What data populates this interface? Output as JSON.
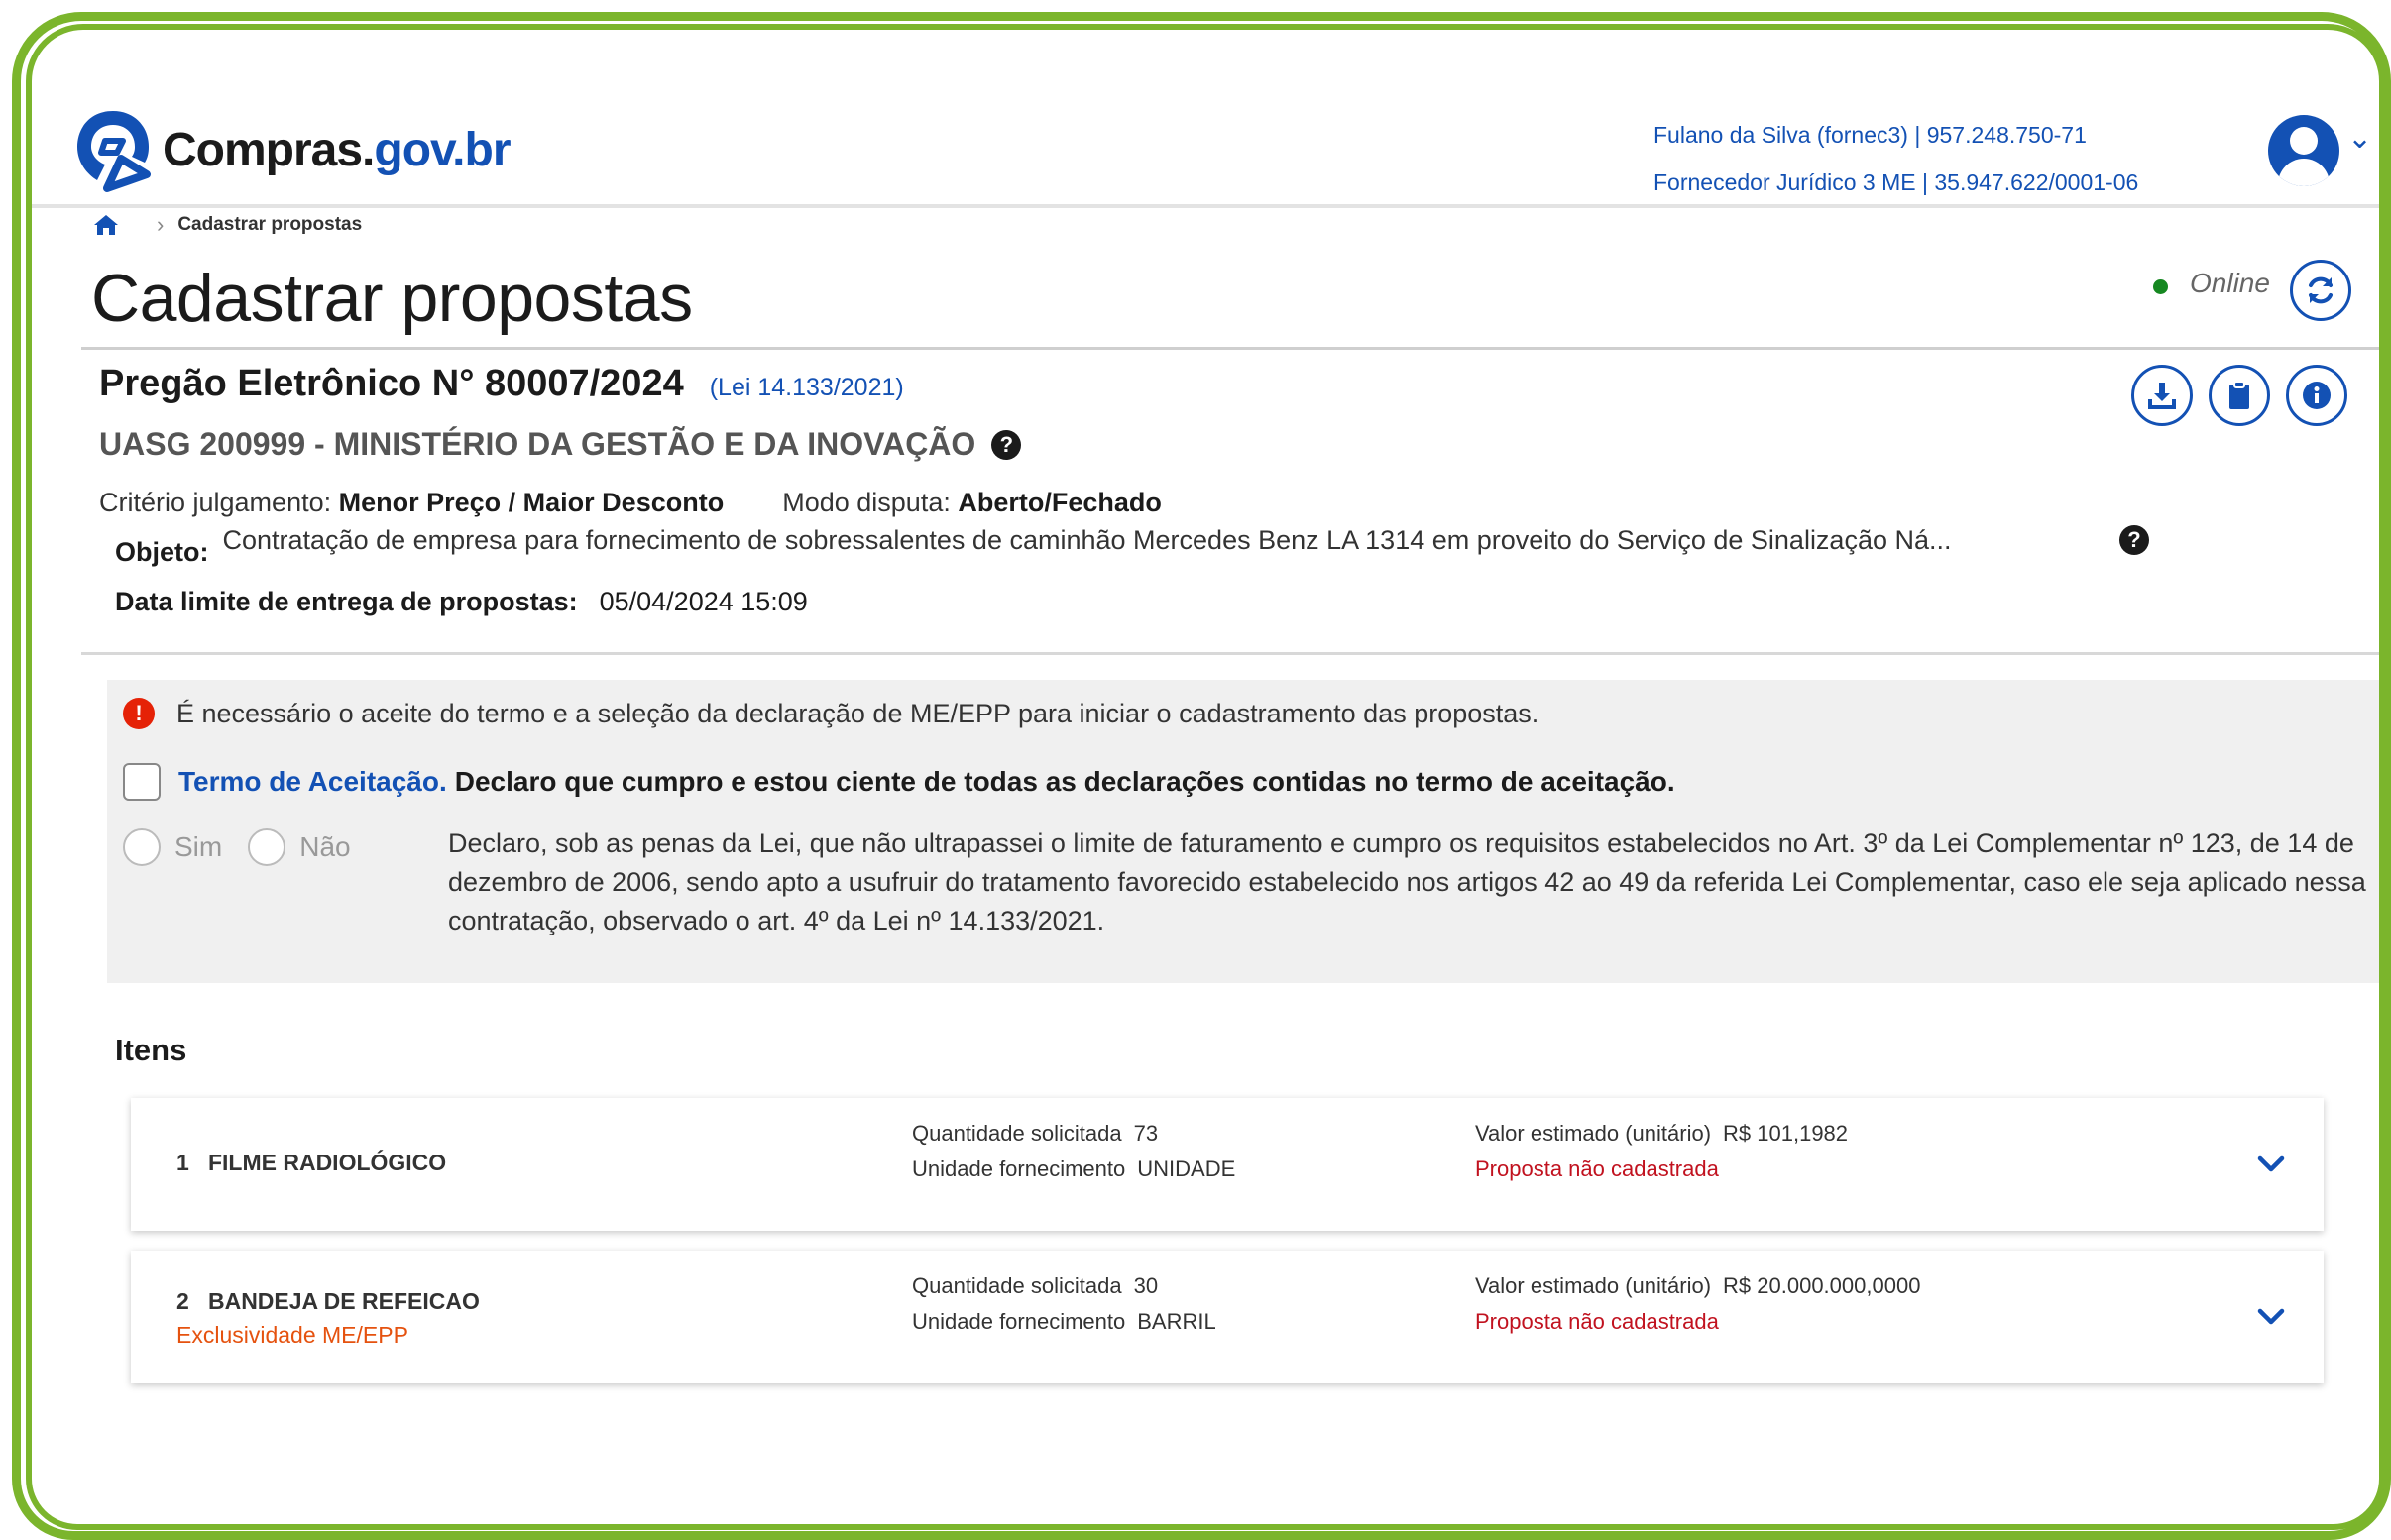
{
  "header": {
    "logo_text": "Compras.",
    "logo_tld": "gov.br",
    "user_line1": "Fulano da Silva (fornec3) | 957.248.750-71",
    "user_line2": "Fornecedor Jurídico 3 ME | 35.947.622/0001-06"
  },
  "breadcrumb": {
    "current": "Cadastrar propostas"
  },
  "page": {
    "title": "Cadastrar propostas",
    "status": "Online"
  },
  "pregao": {
    "title": "Pregão Eletrônico N° 80007/2024",
    "lei": "(Lei 14.133/2021)",
    "uasg": "UASG 200999 - MINISTÉRIO DA GESTÃO E DA INOVAÇÃO",
    "criterio_label": "Critério julgamento:",
    "criterio_value": "Menor Preço / Maior Desconto",
    "modo_label": "Modo disputa:",
    "modo_value": "Aberto/Fechado",
    "objeto_label": "Objeto:",
    "objeto_value": "Contratação de empresa para fornecimento de sobressalentes de caminhão Mercedes Benz LA 1314 em proveito do Serviço de Sinalização Ná...",
    "data_label": "Data limite de entrega de propostas:",
    "data_value": "05/04/2024 15:09"
  },
  "alert": {
    "message": "É necessário o aceite do termo e a seleção da declaração de ME/EPP para iniciar o cadastramento das propostas.",
    "termo_link": "Termo de Aceitação.",
    "termo_text": "Declaro que cumpro e estou ciente de todas as declarações contidas no termo de aceitação.",
    "sim": "Sim",
    "nao": "Não",
    "declaro": "Declaro, sob as penas da Lei, que não ultrapassei o limite de faturamento e cumpro os requisitos estabelecidos no Art. 3º da Lei Complementar nº 123, de 14 de dezembro de 2006, sendo apto a usufruir do tratamento favorecido estabelecido nos artigos 42 ao 49 da referida Lei Complementar, caso ele seja aplicado nessa contratação, observado o art. 4º da Lei nº 14.133/2021."
  },
  "itens": {
    "title": "Itens",
    "qtd_label": "Quantidade solicitada",
    "unid_label": "Unidade fornecimento",
    "valor_label": "Valor estimado (unitário)",
    "list": [
      {
        "num": "1",
        "name": "FILME RADIOLÓGICO",
        "excl": "",
        "qtd": "73",
        "unid": "UNIDADE",
        "valor": "R$ 101,1982",
        "status": "Proposta não cadastrada"
      },
      {
        "num": "2",
        "name": "BANDEJA DE REFEICAO",
        "excl": "Exclusividade ME/EPP",
        "qtd": "30",
        "unid": "BARRIL",
        "valor": "R$ 20.000.000,0000",
        "status": "Proposta não cadastrada"
      }
    ]
  },
  "colors": {
    "brand_blue": "#1351b4",
    "frame_green": "#7bb52c",
    "error_red": "#c1121f",
    "online_green": "#168821"
  },
  "icons": [
    "home-icon",
    "refresh-icon",
    "download-icon",
    "clipboard-icon",
    "info-icon",
    "help-icon",
    "alert-icon",
    "chevron-down-icon",
    "user-icon"
  ]
}
